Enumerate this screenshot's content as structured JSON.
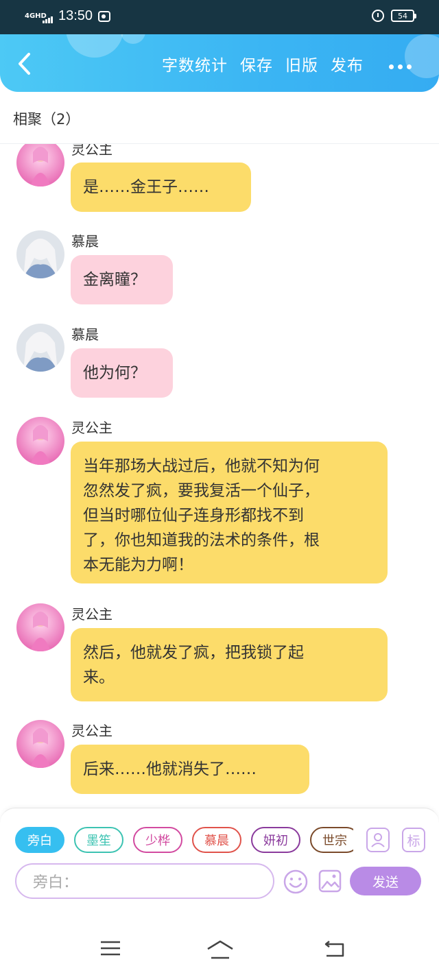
{
  "status_bar": {
    "network": "4GHD",
    "time": "13:50",
    "battery": "54"
  },
  "header": {
    "actions": [
      {
        "label": "字数统计"
      },
      {
        "label": "保存"
      },
      {
        "label": "旧版"
      },
      {
        "label": "发布"
      }
    ]
  },
  "page_title": "相聚（2）",
  "messages": [
    {
      "sender": "灵公主",
      "text": "是……金王子……",
      "color": "#fcdc6a"
    },
    {
      "sender": "慕晨",
      "text": "金离瞳？",
      "color": "#fdd2dd"
    },
    {
      "sender": "慕晨",
      "text": "他为何？",
      "color": "#fdd2dd"
    },
    {
      "sender": "灵公主",
      "lines": [
        "当年那场大战过后，他就不知为何",
        "忽然发了疯，要我复活一个仙子，",
        "但当时哪位仙子连身形都找不到",
        "了，你也知道我的法术的条件，根",
        "本无能为力啊！"
      ],
      "color": "#fcdc6a"
    },
    {
      "sender": "灵公主",
      "lines": [
        "然后，他就发了疯，把我锁了起",
        "来。"
      ],
      "color": "#fcdc6a"
    },
    {
      "sender": "灵公主",
      "text": "后来……他就消失了……",
      "color": "#fcdc6a"
    }
  ],
  "characters": [
    {
      "label": "旁白",
      "color": "#36bff0",
      "active": true
    },
    {
      "label": "墨笙",
      "color": "#3cc3b2"
    },
    {
      "label": "少桦",
      "color": "#d24aa0"
    },
    {
      "label": "慕晨",
      "color": "#e0524a"
    },
    {
      "label": "妍初",
      "color": "#8a3a9c"
    },
    {
      "label": "世宗",
      "color": "#7a4a2a"
    }
  ],
  "input": {
    "placeholder": "旁白："
  },
  "tools": {
    "mark_label": "标"
  },
  "send_label": "发送",
  "colors": {
    "accent": "#3bb5f3",
    "send": "#b98be6"
  }
}
